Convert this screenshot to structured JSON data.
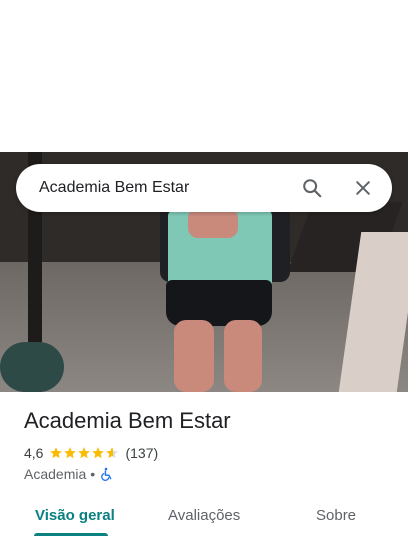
{
  "search": {
    "query": "Academia Bem Estar",
    "search_icon": "search-icon",
    "close_icon": "close-icon"
  },
  "photo": {
    "description_icon": "place-photo"
  },
  "place": {
    "name": "Academia Bem Estar",
    "rating": "4,6",
    "rating_value": 4.6,
    "review_count": "(137)",
    "category": "Academia",
    "separator": "•",
    "accessibility_icon": "wheelchair-icon"
  },
  "tabs": [
    {
      "label": "Visão geral",
      "active": true
    },
    {
      "label": "Avaliações",
      "active": false
    },
    {
      "label": "Sobre",
      "active": false
    }
  ],
  "colors": {
    "accent": "#0b8080",
    "star": "#fbbc04",
    "accessibility": "#1a73e8"
  }
}
